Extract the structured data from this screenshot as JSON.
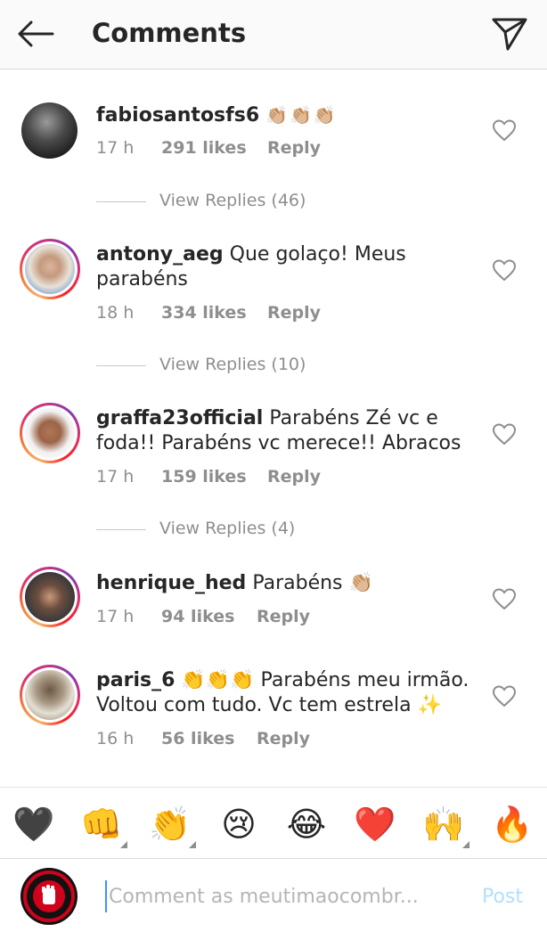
{
  "header": {
    "title": "Comments",
    "back_icon": "arrow-left-icon",
    "send_icon": "paper-plane-icon"
  },
  "comments": [
    {
      "username": "fabiosantosfs6",
      "text": "👏🏼👏🏼👏🏼",
      "time": "17 h",
      "likes": "291 likes",
      "reply": "Reply",
      "view_replies": "View Replies (46)"
    },
    {
      "username": "antony_aeg",
      "text": "Que golaço! Meus parabéns",
      "time": "18 h",
      "likes": "334 likes",
      "reply": "Reply",
      "view_replies": "View Replies (10)"
    },
    {
      "username": "graffa23official",
      "text": "Parabéns Zé vc e foda!! Parabéns vc merece!! Abracos",
      "time": "17 h",
      "likes": "159 likes",
      "reply": "Reply",
      "view_replies": "View Replies (4)"
    },
    {
      "username": "henrique_hed",
      "text": "Parabéns 👏🏼",
      "time": "17 h",
      "likes": "94 likes",
      "reply": "Reply"
    },
    {
      "username": "paris_6",
      "text": "👏👏👏 Parabéns meu irmão. Voltou com tudo. Vc tem estrela ✨",
      "time": "16 h",
      "likes": "56 likes",
      "reply": "Reply"
    }
  ],
  "emoji_bar": [
    "🖤",
    "👊",
    "👏",
    "😢",
    "😂",
    "❤️",
    "🙌",
    "🔥"
  ],
  "input": {
    "placeholder": "Comment as meutimaocombr...",
    "post_label": "Post"
  },
  "colors": {
    "accent": "#3897f0",
    "post_disabled": "#b2dffc",
    "meta": "#8e8e8e"
  }
}
